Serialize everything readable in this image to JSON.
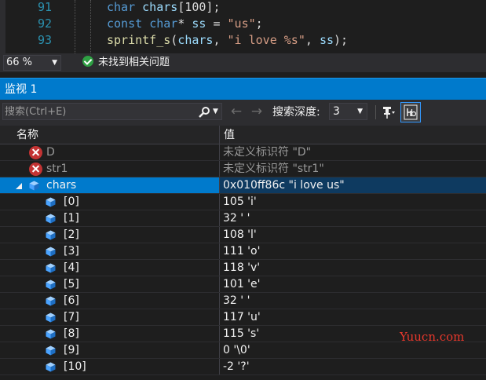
{
  "editor": {
    "lines": [
      {
        "number": "91",
        "tokens": [
          {
            "t": "char",
            "c": "kw"
          },
          {
            "t": " ",
            "c": "pl"
          },
          {
            "t": "chars",
            "c": "id"
          },
          {
            "t": "[100];",
            "c": "pl"
          }
        ]
      },
      {
        "number": "92",
        "tokens": [
          {
            "t": "const",
            "c": "kw"
          },
          {
            "t": " ",
            "c": "pl"
          },
          {
            "t": "char",
            "c": "kw"
          },
          {
            "t": "* ",
            "c": "pl"
          },
          {
            "t": "ss",
            "c": "id"
          },
          {
            "t": " = ",
            "c": "pl"
          },
          {
            "t": "\"us\"",
            "c": "str"
          },
          {
            "t": ";",
            "c": "pl"
          }
        ]
      },
      {
        "number": "93",
        "tokens": [
          {
            "t": "sprintf_s",
            "c": "fn"
          },
          {
            "t": "(",
            "c": "pl"
          },
          {
            "t": "chars",
            "c": "id"
          },
          {
            "t": ", ",
            "c": "pl"
          },
          {
            "t": "\"i love %s\"",
            "c": "str"
          },
          {
            "t": ", ",
            "c": "pl"
          },
          {
            "t": "ss",
            "c": "id"
          },
          {
            "t": ");",
            "c": "pl"
          }
        ]
      }
    ]
  },
  "status": {
    "zoom": "66 %",
    "issues": "未找到相关问题"
  },
  "watch": {
    "title": "监视 1",
    "search_placeholder": "搜索(Ctrl+E)",
    "depth_label": "搜索深度:",
    "depth_value": "3",
    "columns": {
      "name": "名称",
      "value": "值"
    },
    "errors": [
      {
        "name": "D",
        "value": "未定义标识符 \"D\""
      },
      {
        "name": "str1",
        "value": "未定义标识符 \"str1\""
      }
    ],
    "chars": {
      "name": "chars",
      "value": "0x010ff86c \"i love us\""
    },
    "elements": [
      {
        "name": "[0]",
        "value": "105 'i'"
      },
      {
        "name": "[1]",
        "value": "32 ' '"
      },
      {
        "name": "[2]",
        "value": "108 'l'"
      },
      {
        "name": "[3]",
        "value": "111 'o'"
      },
      {
        "name": "[4]",
        "value": "118 'v'"
      },
      {
        "name": "[5]",
        "value": "101 'e'"
      },
      {
        "name": "[6]",
        "value": "32 ' '"
      },
      {
        "name": "[7]",
        "value": "117 'u'"
      },
      {
        "name": "[8]",
        "value": "115 's'"
      },
      {
        "name": "[9]",
        "value": "0 '\\0'"
      },
      {
        "name": "[10]",
        "value": "-2 '?'"
      }
    ]
  },
  "watermark": "Yuucn.com",
  "colors": {
    "accent": "#007acc",
    "error_icon": "#c33333",
    "check_icon": "#2ea043",
    "cube_icon": "#4aa3ff",
    "watermark": "#e8382c"
  }
}
